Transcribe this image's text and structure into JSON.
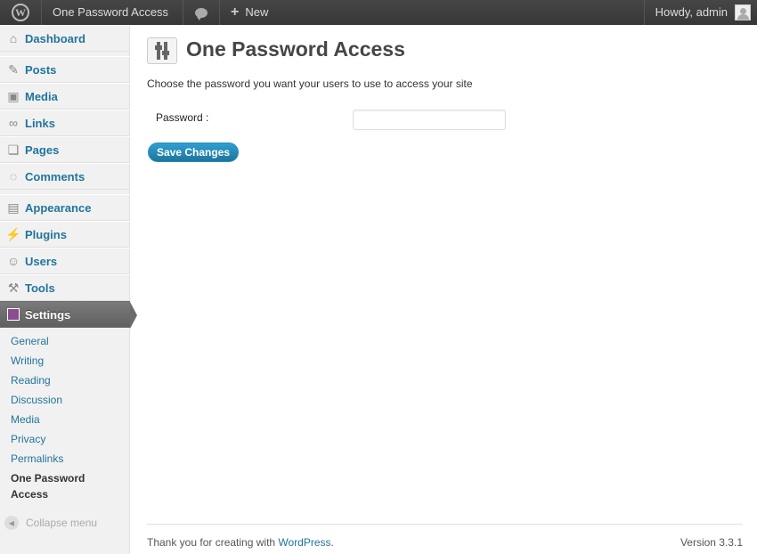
{
  "adminbar": {
    "site_name": "One Password Access",
    "new_label": "New",
    "greeting": "Howdy, admin"
  },
  "sidebar": {
    "items": [
      {
        "label": "Dashboard",
        "icon": "dashboard-icon"
      },
      {
        "label": "Posts",
        "icon": "pin-icon"
      },
      {
        "label": "Media",
        "icon": "media-icon"
      },
      {
        "label": "Links",
        "icon": "link-icon"
      },
      {
        "label": "Pages",
        "icon": "page-icon"
      },
      {
        "label": "Comments",
        "icon": "comment-icon"
      },
      {
        "label": "Appearance",
        "icon": "appearance-icon"
      },
      {
        "label": "Plugins",
        "icon": "plugin-icon"
      },
      {
        "label": "Users",
        "icon": "users-icon"
      },
      {
        "label": "Tools",
        "icon": "tools-icon"
      },
      {
        "label": "Settings",
        "icon": "settings-icon"
      }
    ],
    "submenu": [
      "General",
      "Writing",
      "Reading",
      "Discussion",
      "Media",
      "Privacy",
      "Permalinks"
    ],
    "submenu_current": [
      "One Password",
      "Access"
    ],
    "collapse": "Collapse menu"
  },
  "main": {
    "title": "One Password Access",
    "description": "Choose the password you want your users to use to access your site",
    "password_label": "Password :",
    "password_value": "",
    "save_label": "Save Changes"
  },
  "footer": {
    "thanks": "Thank you for creating with ",
    "link": "WordPress",
    "period": ".",
    "version": "Version 3.3.1"
  },
  "colors": {
    "link": "#21759b",
    "adminbar": "#464646",
    "button": "#21759b"
  }
}
